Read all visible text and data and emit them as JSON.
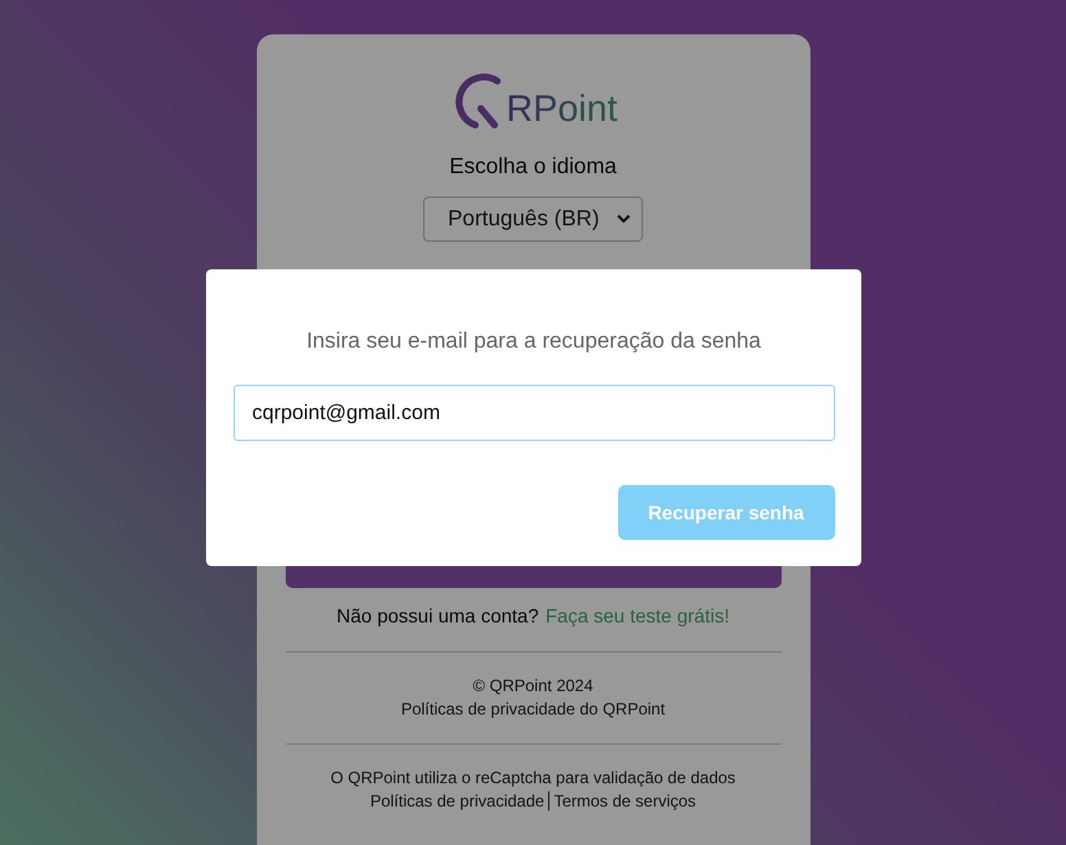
{
  "logo": {
    "text": "RPoint"
  },
  "language": {
    "label": "Escolha o idioma",
    "value": "Português (BR)"
  },
  "signup": {
    "prompt": "Não possui uma conta?",
    "link": "Faça seu teste grátis!"
  },
  "footer": {
    "copyright": "© QRPoint 2024",
    "privacy_link": "Políticas de privacidade do QRPoint"
  },
  "recaptcha": {
    "note": "O QRPoint utiliza o reCaptcha para validação de dados",
    "links": [
      "Políticas de privacidade",
      "Termos de serviços"
    ]
  },
  "modal": {
    "title": "Insira seu e-mail para a recuperação da senha",
    "email": {
      "value": "cqrpoint@gmail.com"
    },
    "button": {
      "label": "Recuperar senha",
      "disabled": true
    }
  }
}
